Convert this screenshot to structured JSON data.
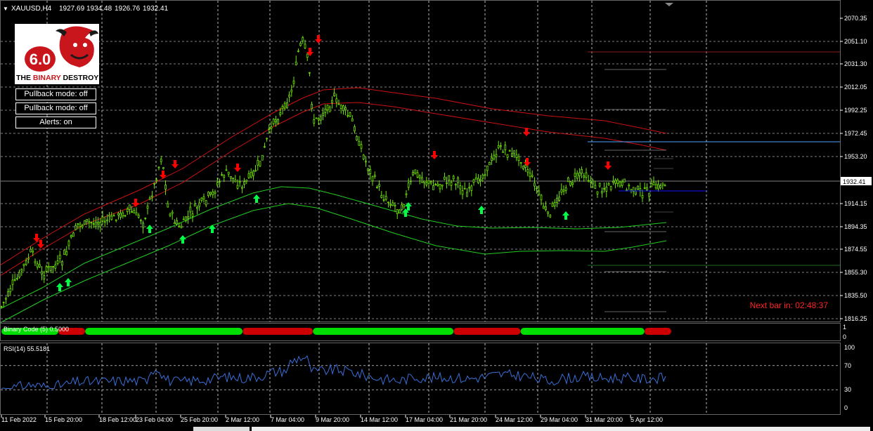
{
  "header": {
    "dropdown_glyph": "▼",
    "symbol": "XAUUSD,H4",
    "open": "1927.69",
    "high": "1934.48",
    "low": "1926.76",
    "close": "1932.41"
  },
  "logo": {
    "version": "6.0",
    "brand_prefix": "THE ",
    "brand_highlight": "BINARY",
    "brand_suffix": " DESTROYER"
  },
  "controls": [
    {
      "label": "Pullback mode: off"
    },
    {
      "label": "Pullback mode: off"
    },
    {
      "label": "Alerts: on"
    }
  ],
  "price_axis": {
    "ticks": [
      "2070.35",
      "2051.10",
      "2031.30",
      "2012.05",
      "1992.25",
      "1972.45",
      "1953.20",
      "1932.41",
      "1914.15",
      "1894.35",
      "1874.55",
      "1855.30",
      "1835.50",
      "1816.25"
    ],
    "current": "1932.41"
  },
  "next_bar": "Next bar in: 02:48:37",
  "binary_panel": {
    "label": "Binary Code (5) 0.5000",
    "axis_top": "1",
    "axis_bottom": "0",
    "segments": [
      {
        "state": "up",
        "from": 0,
        "to": 0.085
      },
      {
        "state": "down",
        "from": 0.085,
        "to": 0.125
      },
      {
        "state": "up",
        "from": 0.125,
        "to": 0.36
      },
      {
        "state": "down",
        "from": 0.36,
        "to": 0.465
      },
      {
        "state": "up",
        "from": 0.465,
        "to": 0.675
      },
      {
        "state": "down",
        "from": 0.675,
        "to": 0.775
      },
      {
        "state": "up",
        "from": 0.775,
        "to": 0.96
      },
      {
        "state": "down",
        "from": 0.96,
        "to": 1
      }
    ],
    "colors": {
      "up": "#00dd00",
      "down": "#cc0000"
    }
  },
  "rsi_panel": {
    "label": "RSI(14) 55.5181",
    "ticks": [
      "100",
      "70",
      "30",
      "0"
    ]
  },
  "time_axis": [
    "11 Feb 2022",
    "15 Feb 20:00",
    "18 Feb 12:00",
    "23 Feb 04:00",
    "25 Feb 20:00",
    "2 Mar 12:00",
    "7 Mar 04:00",
    "9 Mar 20:00",
    "14 Mar 12:00",
    "17 Mar 04:00",
    "21 Mar 20:00",
    "24 Mar 12:00",
    "29 Mar 04:00",
    "31 Mar 20:00",
    "5 Apr 12:00"
  ],
  "colors": {
    "background": "#000000",
    "candle": "#7cfc00",
    "upper_band": "#cc1111",
    "lower_band": "#22cc22",
    "rsi": "#3a6fd8",
    "arrow_up": "#00ff44",
    "arrow_down": "#ff0000",
    "next_bar": "#ff2222",
    "grid": "#ffffff"
  },
  "icons": {
    "buy_signal": "arrow-up-icon",
    "sell_signal": "arrow-down-icon"
  }
}
